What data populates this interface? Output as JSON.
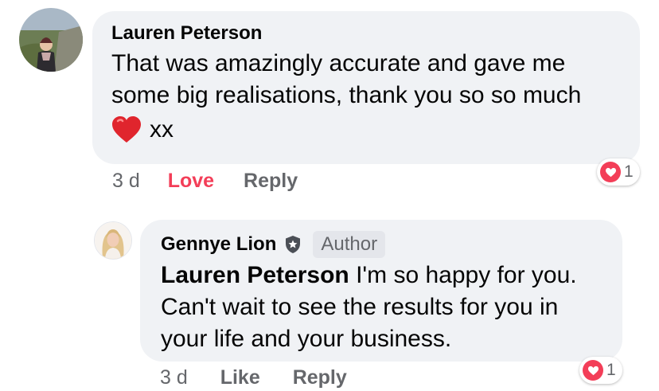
{
  "comments": [
    {
      "author": "Lauren Peterson",
      "text_line1": "That was amazingly accurate and gave me",
      "text_line2": "some big realisations, thank you so so much",
      "emoji_icon": "red-heart-emoji",
      "text_suffix": "xx",
      "time": "3 d",
      "reaction_action": "Love",
      "reply_label": "Reply",
      "reaction_icon": "heart-icon",
      "reaction_count": "1",
      "reaction_color": "#f33e58"
    },
    {
      "author": "Gennye Lion",
      "verified_icon": "shield-badge-icon",
      "author_badge": "Author",
      "mention": "Lauren Peterson",
      "text_line1": " I'm so happy for you.",
      "text_line2": "Can't wait to see the results for you in",
      "text_line3": "your life and your business.",
      "time": "3 d",
      "like_label": "Like",
      "reply_label": "Reply",
      "reaction_icon": "heart-icon",
      "reaction_count": "1"
    }
  ]
}
